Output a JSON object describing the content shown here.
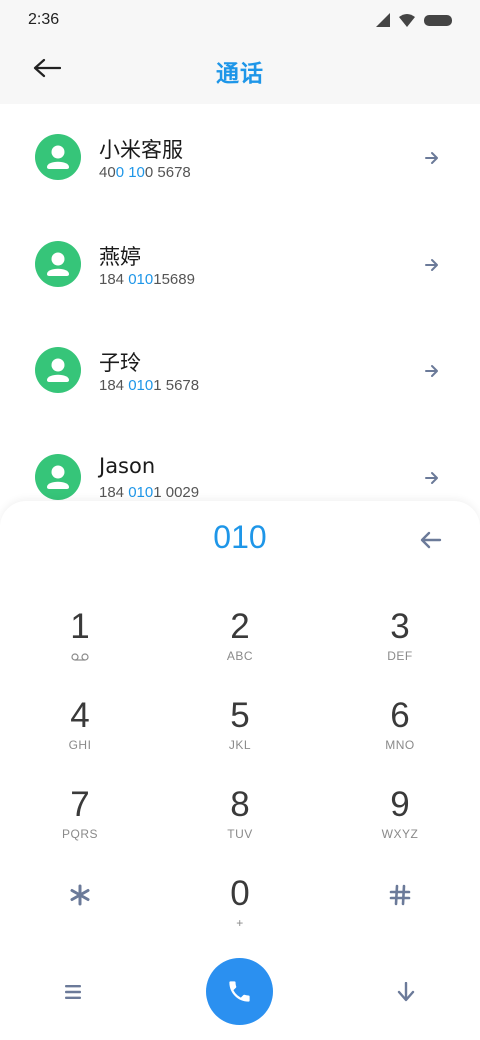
{
  "status_bar": {
    "time": "2:36",
    "icons": [
      "signal-icon",
      "wifi-icon",
      "battery-icon"
    ]
  },
  "header": {
    "title": "通话",
    "back_icon": "back-arrow-icon"
  },
  "contacts": [
    {
      "name": "小米客服",
      "number_parts": [
        {
          "text": "40",
          "hl": false
        },
        {
          "text": "0",
          "hl": true
        },
        {
          "text": " ",
          "hl": false
        },
        {
          "text": "10",
          "hl": true
        },
        {
          "text": "0 5678",
          "hl": false
        }
      ]
    },
    {
      "name": "燕婷",
      "number_parts": [
        {
          "text": "184 ",
          "hl": false
        },
        {
          "text": "010",
          "hl": true
        },
        {
          "text": "15689",
          "hl": false
        }
      ]
    },
    {
      "name": "子玲",
      "number_parts": [
        {
          "text": "184 ",
          "hl": false
        },
        {
          "text": "010",
          "hl": true
        },
        {
          "text": "1 5678",
          "hl": false
        }
      ]
    },
    {
      "name": "Jason",
      "number_parts": [
        {
          "text": "184 ",
          "hl": false
        },
        {
          "text": "010",
          "hl": true
        },
        {
          "text": "1 0029",
          "hl": false
        }
      ]
    }
  ],
  "dialer": {
    "display": "010",
    "keys": [
      {
        "digit": "1",
        "letters": "",
        "voicemail": true
      },
      {
        "digit": "2",
        "letters": "ABC"
      },
      {
        "digit": "3",
        "letters": "DEF"
      },
      {
        "digit": "4",
        "letters": "GHI"
      },
      {
        "digit": "5",
        "letters": "JKL"
      },
      {
        "digit": "6",
        "letters": "MNO"
      },
      {
        "digit": "7",
        "letters": "PQRS"
      },
      {
        "digit": "8",
        "letters": "TUV"
      },
      {
        "digit": "9",
        "letters": "WXYZ"
      },
      {
        "symbol": "star-icon"
      },
      {
        "digit": "0",
        "letters": "+"
      },
      {
        "symbol": "hash-icon"
      }
    ]
  },
  "bottom_bar": {
    "menu_icon": "menu-icon",
    "call_icon": "phone-icon",
    "collapse_icon": "chevron-down-arrow-icon"
  },
  "colors": {
    "accent": "#1e96e8",
    "avatar": "#36c579",
    "call_button": "#2b90f0",
    "muted_icon": "#6b7a99"
  }
}
